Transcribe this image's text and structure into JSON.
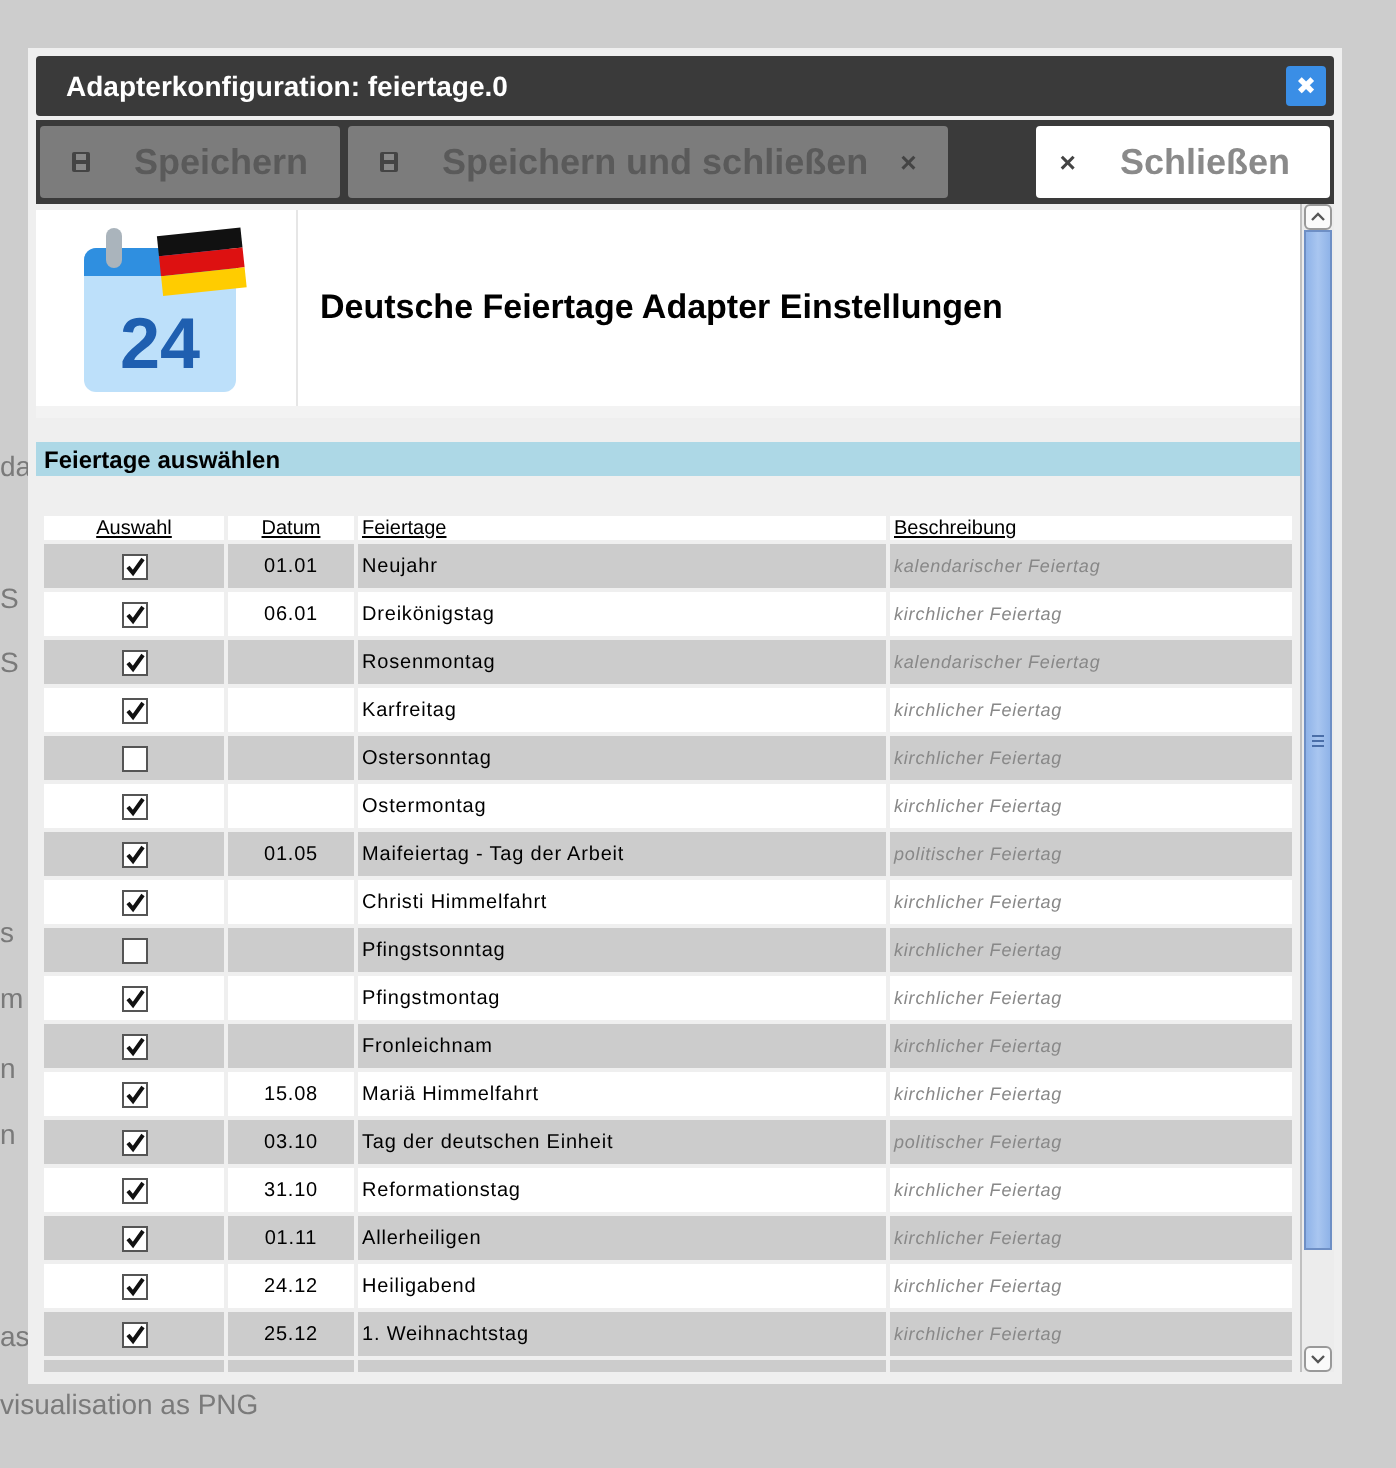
{
  "background_texts": [
    "da",
    "S",
    "S",
    "s",
    "m",
    "n",
    "n",
    "as",
    "visualisation as PNG"
  ],
  "dialog": {
    "title": "Adapterkonfiguration: feiertage.0",
    "close_symbol": "✖"
  },
  "toolbar": [
    {
      "kind": "save",
      "label": "Speichern",
      "disabled": true
    },
    {
      "kind": "save",
      "label": "Speichern und schließen",
      "disabled": true,
      "trailing": "×"
    },
    {
      "kind": "close",
      "label": "Schließen",
      "disabled": false,
      "leading": "×"
    }
  ],
  "header": {
    "calendar_day": "24",
    "title": "Deutsche Feiertage Adapter Einstellungen"
  },
  "section": {
    "title": "Feiertage auswählen"
  },
  "table": {
    "columns": [
      "Auswahl",
      "Datum",
      "Feiertage",
      "Beschreibung"
    ],
    "rows": [
      {
        "checked": true,
        "date": "01.01",
        "name": "Neujahr",
        "description": "kalendarischer Feiertag"
      },
      {
        "checked": true,
        "date": "06.01",
        "name": "Dreikönigstag",
        "description": "kirchlicher Feiertag"
      },
      {
        "checked": true,
        "date": "",
        "name": "Rosenmontag",
        "description": "kalendarischer Feiertag"
      },
      {
        "checked": true,
        "date": "",
        "name": "Karfreitag",
        "description": "kirchlicher Feiertag"
      },
      {
        "checked": false,
        "date": "",
        "name": "Ostersonntag",
        "description": "kirchlicher Feiertag"
      },
      {
        "checked": true,
        "date": "",
        "name": "Ostermontag",
        "description": "kirchlicher Feiertag"
      },
      {
        "checked": true,
        "date": "01.05",
        "name": "Maifeiertag - Tag der Arbeit",
        "description": "politischer Feiertag"
      },
      {
        "checked": true,
        "date": "",
        "name": "Christi Himmelfahrt",
        "description": "kirchlicher Feiertag"
      },
      {
        "checked": false,
        "date": "",
        "name": "Pfingstsonntag",
        "description": "kirchlicher Feiertag"
      },
      {
        "checked": true,
        "date": "",
        "name": "Pfingstmontag",
        "description": "kirchlicher Feiertag"
      },
      {
        "checked": true,
        "date": "",
        "name": "Fronleichnam",
        "description": "kirchlicher Feiertag"
      },
      {
        "checked": true,
        "date": "15.08",
        "name": "Mariä Himmelfahrt",
        "description": "kirchlicher Feiertag"
      },
      {
        "checked": true,
        "date": "03.10",
        "name": "Tag der deutschen Einheit",
        "description": "politischer Feiertag"
      },
      {
        "checked": true,
        "date": "31.10",
        "name": "Reformationstag",
        "description": "kirchlicher Feiertag"
      },
      {
        "checked": true,
        "date": "01.11",
        "name": "Allerheiligen",
        "description": "kirchlicher Feiertag"
      },
      {
        "checked": true,
        "date": "24.12",
        "name": "Heiligabend",
        "description": "kirchlicher Feiertag"
      },
      {
        "checked": true,
        "date": "25.12",
        "name": "1. Weihnachtstag",
        "description": "kirchlicher Feiertag"
      }
    ]
  }
}
